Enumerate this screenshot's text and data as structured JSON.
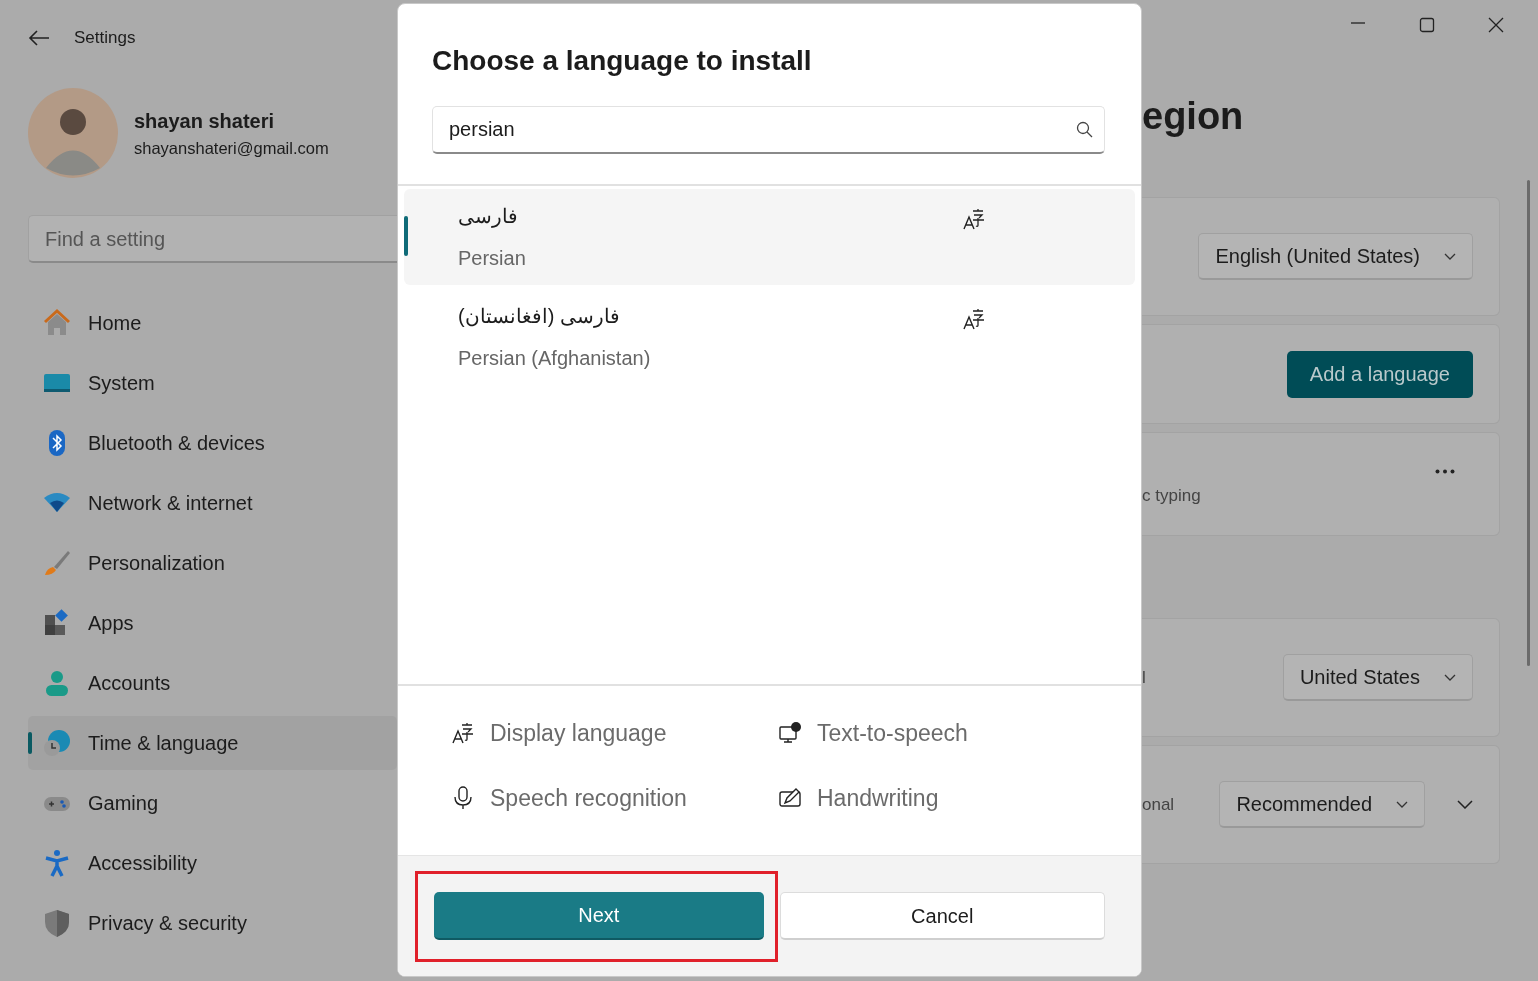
{
  "window": {
    "title": "Settings"
  },
  "profile": {
    "name": "shayan shateri",
    "email": "shayanshateri@gmail.com"
  },
  "search": {
    "placeholder": "Find a setting"
  },
  "nav": [
    {
      "label": "Home",
      "kind": "home",
      "selected": false
    },
    {
      "label": "System",
      "kind": "system",
      "selected": false
    },
    {
      "label": "Bluetooth & devices",
      "kind": "bluetooth",
      "selected": false
    },
    {
      "label": "Network & internet",
      "kind": "network",
      "selected": false
    },
    {
      "label": "Personalization",
      "kind": "brush",
      "selected": false
    },
    {
      "label": "Apps",
      "kind": "apps",
      "selected": false
    },
    {
      "label": "Accounts",
      "kind": "accounts",
      "selected": false
    },
    {
      "label": "Time & language",
      "kind": "time",
      "selected": true
    },
    {
      "label": "Gaming",
      "kind": "gaming",
      "selected": false
    },
    {
      "label": "Accessibility",
      "kind": "accessibility",
      "selected": false
    },
    {
      "label": "Privacy & security",
      "kind": "privacy",
      "selected": false
    }
  ],
  "page": {
    "title_fragment": "egion",
    "groups": [
      [
        {
          "kind": "dropdown",
          "value": "English (United States)"
        },
        {
          "kind": "button",
          "label": "Add a language"
        },
        {
          "kind": "more",
          "text_fragment": "c typing"
        }
      ],
      [
        {
          "kind": "dropdown",
          "text_fragment": "l",
          "value": "United States"
        },
        {
          "kind": "dropdown",
          "text_fragment": "onal",
          "value": "Recommended",
          "expandable": true
        }
      ]
    ]
  },
  "dialog": {
    "title": "Choose a language to install",
    "search_value": "persian",
    "languages": [
      {
        "native": "فارسی",
        "name": "Persian",
        "display_language": true,
        "selected": true
      },
      {
        "native": "فارسی (افغانستان)",
        "name": "Persian (Afghanistan)",
        "display_language": true,
        "selected": false
      }
    ],
    "features": [
      {
        "kind": "display",
        "label": "Display language"
      },
      {
        "kind": "tts",
        "label": "Text-to-speech"
      },
      {
        "kind": "speech",
        "label": "Speech recognition"
      },
      {
        "kind": "handwriting",
        "label": "Handwriting"
      }
    ],
    "next": {
      "label": "Next",
      "highlighted": true
    },
    "cancel": {
      "label": "Cancel"
    }
  }
}
